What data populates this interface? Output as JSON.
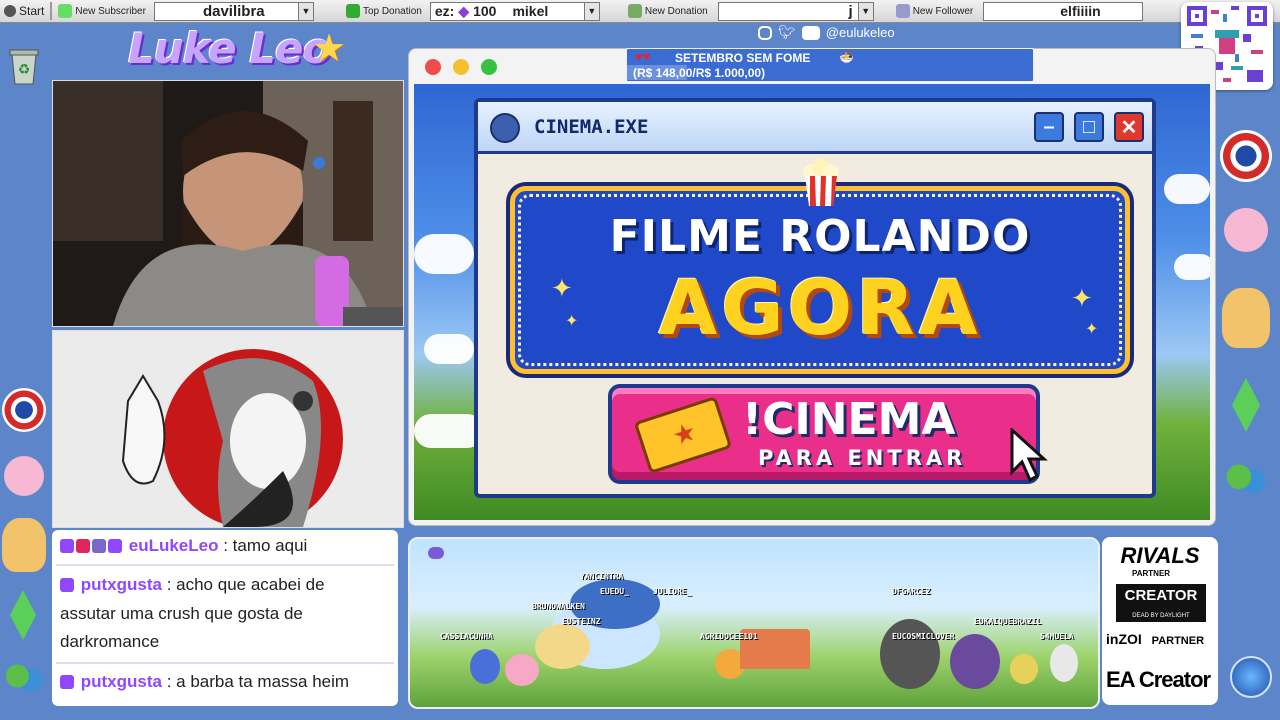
{
  "taskbar": {
    "start_label": "Start",
    "new_subscriber_label": "New Subscriber",
    "subscriber_name": "davilibra",
    "top_donation_label": "Top Donation",
    "top_donation_prefix": "ez:",
    "top_donation_amount": "100",
    "top_donation_name": "mikel",
    "new_donation_label": "New Donation",
    "new_donation_name": "j",
    "new_follower_label": "New Follower",
    "follower_name": "elfiiiin"
  },
  "logo_text": "Luke Leo",
  "social": {
    "handle": "@eulukeleo"
  },
  "goal": {
    "title": "SETEMBRO SEM FOME",
    "progress_text": "(R$ 148,00/R$ 1.000,00)",
    "progress_fraction": 0.148
  },
  "cinema_window": {
    "title": "CINEMA.EXE",
    "headline_line1": "FILME ROLANDO",
    "headline_line2": "AGORA",
    "cta_command": "!CINEMA",
    "cta_sub": "PARA ENTRAR"
  },
  "chat": {
    "messages": [
      {
        "user": "euLukeLeo",
        "text": ": tamo aqui"
      },
      {
        "user": "putxgusta",
        "text": ": acho que acabei de"
      },
      {
        "user": "",
        "text": "assutar uma crush que gosta de"
      },
      {
        "user": "",
        "text": "darkromance"
      },
      {
        "user": "putxgusta",
        "text": ": a barba ta massa heim"
      }
    ]
  },
  "pokemon_names": [
    "YANCINTRA",
    "EUEDU_",
    "JULIORE_",
    "BRUNOWALKEN",
    "EUSTEINZ",
    "CASSIACUNHA",
    "AGRIDOCEE101",
    "DFGARCEZ",
    "EUKAIQUEBRAZIL",
    "EUCOSMICLOVER",
    "S4MUELA"
  ],
  "sponsors": {
    "rivals": "RIVALS",
    "rivals_partner": "PARTNER",
    "creator": "CREATOR",
    "creator_sub": "DEAD BY DAYLIGHT",
    "inzoi": "inZOI",
    "inzoi_partner": "PARTNER",
    "ea": "EA Creator"
  },
  "colors": {
    "background": "#5c86c9",
    "twitch_purple": "#9146ff",
    "cta_pink": "#ea2f8b",
    "marquee_blue": "#1f49c9",
    "marquee_gold": "#ffd21f"
  }
}
